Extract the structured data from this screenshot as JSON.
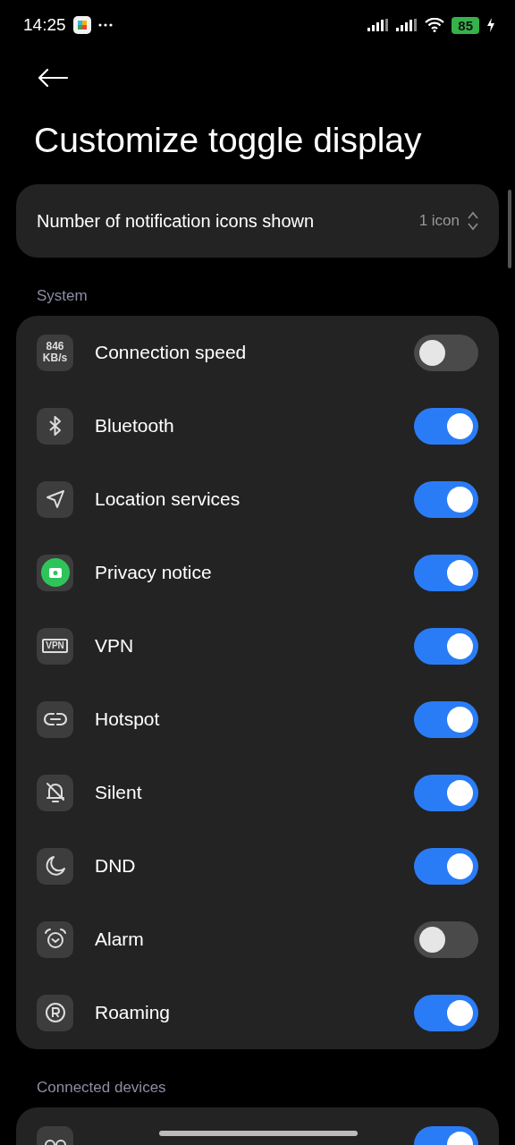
{
  "status_bar": {
    "time": "14:25",
    "battery": "85",
    "charging": true
  },
  "header": {
    "title": "Customize toggle display"
  },
  "notification_setting": {
    "label": "Number of notification icons shown",
    "value": "1 icon"
  },
  "sections": [
    {
      "title": "System",
      "items": [
        {
          "kind": "speed",
          "icon_text": "846\nKB/s",
          "label": "Connection speed",
          "on": false
        },
        {
          "kind": "bluetooth",
          "label": "Bluetooth",
          "on": true
        },
        {
          "kind": "location",
          "label": "Location services",
          "on": true
        },
        {
          "kind": "camera",
          "label": "Privacy notice",
          "on": true
        },
        {
          "kind": "vpn",
          "icon_text": "VPN",
          "label": "VPN",
          "on": true
        },
        {
          "kind": "hotspot",
          "label": "Hotspot",
          "on": true
        },
        {
          "kind": "silent",
          "label": "Silent",
          "on": true
        },
        {
          "kind": "moon",
          "label": "DND",
          "on": true
        },
        {
          "kind": "alarm",
          "label": "Alarm",
          "on": false
        },
        {
          "kind": "roaming",
          "label": "Roaming",
          "on": true
        }
      ]
    },
    {
      "title": "Connected devices",
      "items": [
        {
          "kind": "earbuds",
          "on": true
        }
      ]
    }
  ]
}
